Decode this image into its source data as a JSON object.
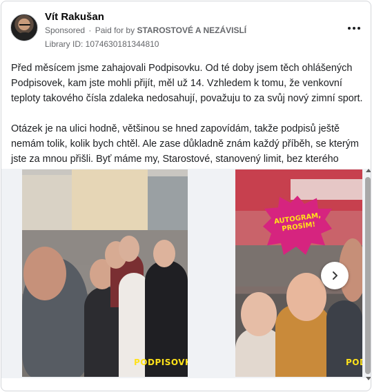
{
  "post": {
    "author": "Vít Rakušan",
    "sponsored": "Sponsored",
    "paid_prefix": "Paid for by",
    "paid_by": "STAROSTOVÉ A NEZÁVISLÍ",
    "library_id": "Library ID: 1074630181344810",
    "paragraph1": "Před měsícem jsme zahajovali Podpisovku. Od té doby jsem těch ohlášených Podpisovek, kam jste mohli přijít, měl už 14. Vzhledem k tomu, že venkovní teploty takového čísla zdaleka nedosahují, považuju to za svůj nový zimní sport.",
    "paragraph2": "Otázek je na ulici hodně, většinou se hned zapovídám, takže podpisů ještě nemám tolik, kolik bych chtěl. Ale zase důkladně znám každý příběh, se kterým jste za mnou přišli. Byť máme my, Starostové, stanovený limit, bez kterého nemůžeme…"
  },
  "carousel": {
    "cards": [
      {
        "brand": "PODPISOVKA"
      },
      {
        "brand": "PODPISOVKA",
        "sticker": "AUTOGRAM, PROSÍM!"
      }
    ],
    "icons": {
      "next": "chevron-right-icon",
      "menu": "more-horizontal-icon"
    }
  },
  "colors": {
    "brand_yellow": "#ffe21a",
    "sticker_magenta": "#d6247f",
    "meta_gray": "#65676b"
  }
}
